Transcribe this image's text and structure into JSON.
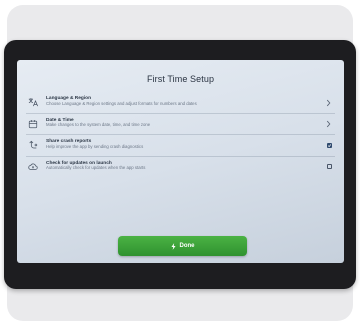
{
  "screen": {
    "title": "First Time Setup"
  },
  "settings": [
    {
      "icon": "translate-icon",
      "title": "Language & Region",
      "subtitle": "Choose Language & Region settings and adjust formats for numbers and dates",
      "control": "chevron"
    },
    {
      "icon": "calendar-icon",
      "title": "Date & Time",
      "subtitle": "Make changes to the system date, time, and time zone",
      "control": "chevron"
    },
    {
      "icon": "crash-report-icon",
      "title": "Share crash reports",
      "subtitle": "Help improve the app by sending crash diagnostics",
      "control": "checkbox",
      "checked": true
    },
    {
      "icon": "cloud-sync-icon",
      "title": "Check for updates on launch",
      "subtitle": "Automatically check for updates when the app starts",
      "control": "checkbox",
      "checked": false
    }
  ],
  "done_button": {
    "label": "Done",
    "icon": "lightning-icon"
  },
  "colors": {
    "accent_green": "#3a9f36",
    "checkbox_checked": "#2f4a6e",
    "bezel": "#1d1d20",
    "screen_background": "#d8e0ea"
  }
}
